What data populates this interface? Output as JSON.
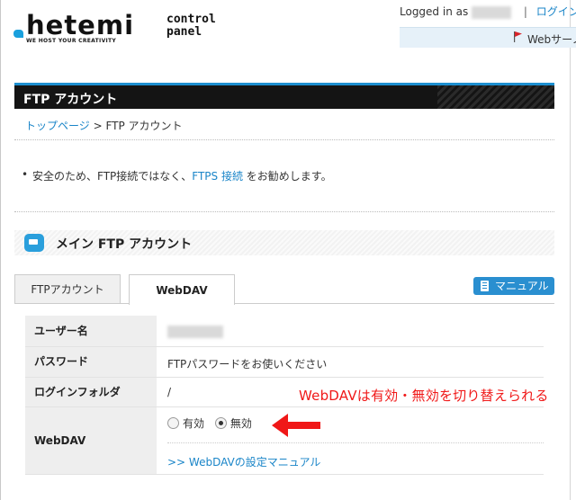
{
  "logo": {
    "main": "hetemi",
    "tagline": "WE HOST YOUR CREATIVITY",
    "control_line1": "control",
    "control_line2": "panel"
  },
  "header": {
    "logged_in_prefix": "Logged in as",
    "separator": "|",
    "login_link": "ログイン履",
    "web_server_label": "Webサーノ"
  },
  "page": {
    "title": "FTP アカウント"
  },
  "breadcrumb": {
    "home": "トップページ",
    "sep": ">",
    "current": "FTP アカウント"
  },
  "notice": {
    "bullet": "•",
    "text_before": "安全のため、FTP接続ではなく、",
    "link": "FTPS 接続",
    "text_after": " をお勧めします。"
  },
  "section": {
    "title": "メイン FTP アカウント"
  },
  "tabs": [
    {
      "label": "FTPアカウント",
      "active": false
    },
    {
      "label": "WebDAV",
      "active": true
    }
  ],
  "manual_button": {
    "label": "マニュアル"
  },
  "table": {
    "rows": [
      {
        "label": "ユーザー名",
        "value": ""
      },
      {
        "label": "パスワード",
        "value": "FTPパスワードをお使いください"
      },
      {
        "label": "ログインフォルダ",
        "value": "/"
      },
      {
        "label": "WebDAV",
        "value": ""
      }
    ],
    "webdav_options": [
      {
        "label": "有効",
        "selected": false
      },
      {
        "label": "無効",
        "selected": true
      }
    ],
    "webdav_manual_link": ">> WebDAVの設定マニュアル"
  },
  "annotation": {
    "text": "WebDAVは有効・無効を切り替えられる",
    "color": "#f01818"
  },
  "colors": {
    "accent": "#1d8fd0",
    "link": "#1a85c8",
    "title_bar": "#141414"
  }
}
